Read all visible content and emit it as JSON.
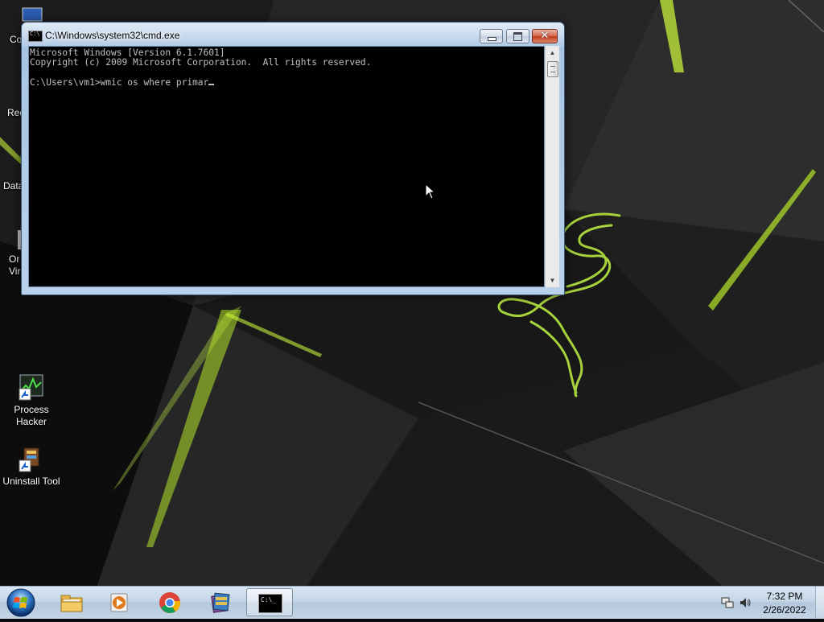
{
  "desktop": {
    "partial_labels": {
      "computer": "Co",
      "recycle_bin": "Rec",
      "data": "Data",
      "oracle_vm": "Or",
      "oracle_vm_line2": "Vir"
    },
    "icons": [
      {
        "id": "process-hacker",
        "label_line1": "Process",
        "label_line2": "Hacker"
      },
      {
        "id": "uninstall-tool",
        "label_line1": "Uninstall Tool",
        "label_line2": ""
      }
    ]
  },
  "cmd_window": {
    "title": "C:\\Windows\\system32\\cmd.exe",
    "lines": [
      "Microsoft Windows [Version 6.1.7601]",
      "Copyright (c) 2009 Microsoft Corporation.  All rights reserved.",
      "",
      "C:\\Users\\vm1>wmic os where primar"
    ],
    "close_glyph": "✕"
  },
  "taskbar": {
    "pinned": [
      {
        "name": "windows-explorer",
        "icon": "folder-icon"
      },
      {
        "name": "windows-media-player",
        "icon": "media-player-icon"
      },
      {
        "name": "google-chrome",
        "icon": "chrome-icon"
      },
      {
        "name": "winrar",
        "icon": "winrar-icon"
      },
      {
        "name": "command-prompt",
        "icon": "cmd-icon",
        "active": true
      }
    ],
    "cmd_icon_text": "C:\\_"
  },
  "tray": {
    "time": "7:32 PM",
    "date": "2/26/2022"
  },
  "colors": {
    "console_bg": "#000000",
    "console_fg": "#c0c0c0",
    "accent_green": "#9acd32",
    "titlebar": "#b9d1ea"
  }
}
